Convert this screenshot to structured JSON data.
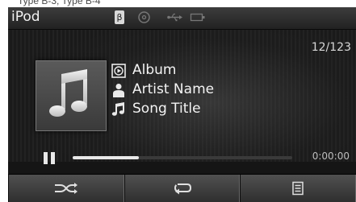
{
  "caption": "Type B-3, Type B-4",
  "header": {
    "title": "iPod",
    "bluetooth_glyph": "β",
    "status_icons": [
      "bluetooth-icon",
      "disc-icon",
      "usb-icon",
      "battery-icon"
    ]
  },
  "track": {
    "counter": "12/123",
    "album": "Album",
    "artist": "Artist Name",
    "song": "Song Title"
  },
  "playback": {
    "state": "paused",
    "progress_fraction": 0.3,
    "time": "0:00:00"
  },
  "controls": {
    "buttons": [
      "shuffle-icon",
      "repeat-icon",
      "list-icon"
    ]
  }
}
